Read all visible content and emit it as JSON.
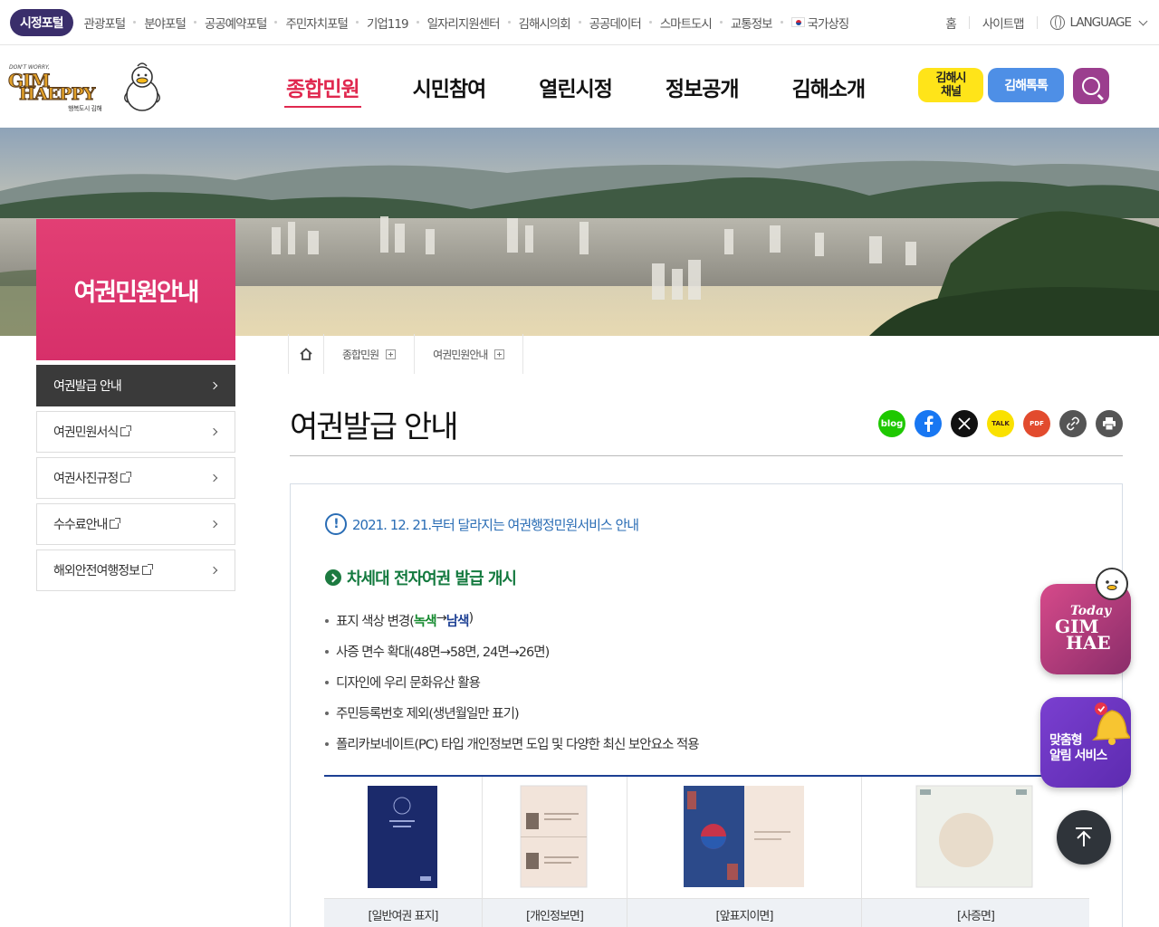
{
  "topbar": {
    "portal_badge": "시정포털",
    "links": [
      "관광포털",
      "분야포털",
      "공공예약포털",
      "주민자치포털",
      "기업119",
      "일자리지원센터",
      "김해시의회",
      "공공데이터",
      "스마트도시",
      "교통정보",
      "국가상징"
    ],
    "home": "홈",
    "sitemap": "사이트맵",
    "language": "LANGUAGE"
  },
  "header": {
    "logo_small": "DON'T WORRY,",
    "logo_gim": "GIM",
    "logo_happy": "HAEPPY",
    "logo_sub": "행복도시 김해",
    "gnb": [
      "종합민원",
      "시민참여",
      "열린시정",
      "정보공개",
      "김해소개"
    ],
    "channel_btn": "김해시\n채널",
    "channel_line1": "김해시",
    "channel_line2": "채널",
    "talk_btn": "김해톡톡"
  },
  "sidebar": {
    "title": "여권민원안내",
    "items": [
      {
        "label": "여권발급 안내",
        "external": false
      },
      {
        "label": "여권민원서식",
        "external": true
      },
      {
        "label": "여권사진규정",
        "external": true
      },
      {
        "label": "수수료안내",
        "external": true
      },
      {
        "label": "해외안전여행정보",
        "external": true
      }
    ]
  },
  "breadcrumb": [
    "종합민원",
    "여권민원안내"
  ],
  "page": {
    "title": "여권발급 안내",
    "sns": [
      {
        "label": "blog",
        "color": "#1ec800"
      },
      {
        "label": "",
        "color": "#1877f2"
      },
      {
        "label": "",
        "color": "#111111"
      },
      {
        "label": "TALK",
        "color": "#fae100"
      },
      {
        "label": "PDF",
        "color": "#e24b2e"
      },
      {
        "label": "",
        "color": "#555555"
      },
      {
        "label": "",
        "color": "#555555"
      }
    ]
  },
  "content": {
    "notice": "2021. 12. 21.부터 달라지는 여권행정민원서비스 안내",
    "section_title": "차세대 전자여권 발급 개시",
    "bullets": {
      "b1_prefix": "표지 색상 변경(",
      "b1_green": "녹색",
      "b1_arrow": "→",
      "b1_navy": "남색",
      "b1_suffix": ")",
      "b2": "사증 면수 확대(48면→58면, 24면→26면)",
      "b3": "디자인에 우리 문화유산 활용",
      "b4": "주민등록번호 제외(생년월일만 표기)",
      "b5": "폴리카보네이트(PC) 타입 개인정보면 도입 및 다양한 최신 보안요소 적용"
    },
    "table_captions": [
      "[일반여권 표지]",
      "[개인정보면]",
      "[앞표지이면]",
      "[사증면]"
    ]
  },
  "floating": {
    "today_1": "Today",
    "today_2": "GIM",
    "today_3": "HAE",
    "alarm_1": "맞춤형",
    "alarm_2": "알림 서비스"
  },
  "colors": {
    "portal_badge": "#3a2e6b",
    "accent": "#e0284f",
    "side_title": "#d7306a",
    "notice_blue": "#2a6db5",
    "section_green": "#147a3f",
    "table_border": "#1c3f93"
  }
}
